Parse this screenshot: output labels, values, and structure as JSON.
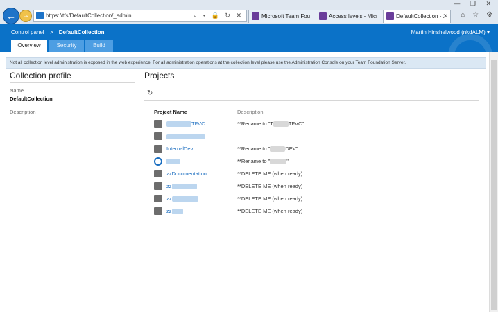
{
  "browser": {
    "url": "https://tfs/DefaultCollection/_admin",
    "tabs": [
      {
        "label": "Microsoft Team Found..."
      },
      {
        "label": "Access levels - Microso..."
      },
      {
        "label": "DefaultCollection - ..."
      }
    ]
  },
  "header": {
    "breadcrumb_root": "Control panel",
    "breadcrumb_sep": ">",
    "breadcrumb_current": "DefaultCollection",
    "user": "Martin Hinshelwood (nkdALM)"
  },
  "page_tabs": [
    {
      "label": "Overview",
      "active": true
    },
    {
      "label": "Security",
      "active": false
    },
    {
      "label": "Build",
      "active": false
    }
  ],
  "info_text": "Not all collection level administration is exposed in the web experience. For all administration operations at the collection level please use the Administration Console on your Team Foundation Server.",
  "profile": {
    "title": "Collection profile",
    "name_label": "Name",
    "name_value": "DefaultCollection",
    "description_label": "Description"
  },
  "projects": {
    "title": "Projects",
    "col_name": "Project Name",
    "col_description": "Description",
    "rows": [
      {
        "name_suffix": "TFVC",
        "desc_prefix": "**Rename to \"T",
        "desc_suffix": "TFVC\""
      },
      {
        "name_suffix": "",
        "desc_prefix": "",
        "desc_suffix": ""
      },
      {
        "name_suffix": "InternalDev",
        "desc_prefix": "**Rename to \"",
        "desc_suffix": "DEV\""
      },
      {
        "name_suffix": "",
        "desc_prefix": "**Rename to \"",
        "desc_suffix": "\""
      },
      {
        "name_suffix": "zzDocumentation",
        "desc_prefix": "**DELETE ME (when ready)",
        "desc_suffix": ""
      },
      {
        "name_suffix": "zz",
        "desc_prefix": "**DELETE ME (when ready)",
        "desc_suffix": ""
      },
      {
        "name_suffix": "zz",
        "desc_prefix": "**DELETE ME (when ready)",
        "desc_suffix": ""
      },
      {
        "name_suffix": "zz",
        "desc_prefix": "**DELETE ME (when ready)",
        "desc_suffix": ""
      }
    ]
  }
}
